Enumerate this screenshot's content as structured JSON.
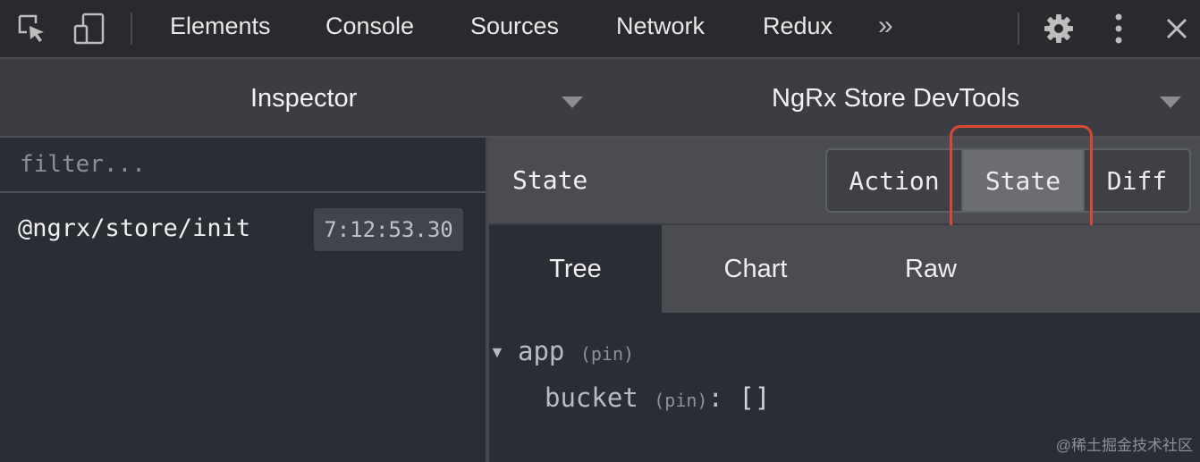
{
  "toolbar": {
    "tabs": [
      "Elements",
      "Console",
      "Sources",
      "Network",
      "Redux"
    ],
    "more_label": "»",
    "icons": [
      "inspect-icon",
      "device-toggle-icon",
      "gear-icon",
      "kebab-icon",
      "close-icon"
    ]
  },
  "panels": {
    "left_label": "Inspector",
    "right_label": "NgRx Store DevTools"
  },
  "left_pane": {
    "filter_placeholder": "filter...",
    "actions": [
      {
        "name": "@ngrx/store/init",
        "time": "7:12:53.30"
      }
    ]
  },
  "right_pane": {
    "title": "State",
    "segments": [
      "Action",
      "State",
      "Diff"
    ],
    "selected_segment": "State",
    "view_tabs": [
      "Tree",
      "Chart",
      "Raw"
    ],
    "selected_view": "Tree",
    "tree": {
      "root_key": "app",
      "root_pin": "(pin)",
      "child_key": "bucket",
      "child_pin": "(pin)",
      "child_colon": ":",
      "child_value": "[]"
    }
  },
  "colors": {
    "highlight": "#d9482f",
    "background": "#2b2d35"
  },
  "watermark": "@稀土掘金技术社区"
}
